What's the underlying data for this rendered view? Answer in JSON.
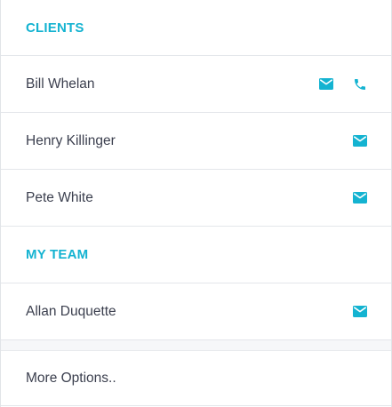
{
  "colors": {
    "accent": "#14b3d1",
    "text": "#3b3f4e",
    "divider": "#e3e6ea"
  },
  "clients": {
    "title": "CLIENTS",
    "contacts": [
      {
        "name": "Bill Whelan",
        "icons": [
          "email-icon",
          "phone-icon"
        ]
      },
      {
        "name": "Henry Killinger",
        "icons": [
          "email-icon"
        ]
      },
      {
        "name": "Pete White",
        "icons": [
          "email-icon"
        ]
      }
    ]
  },
  "team": {
    "title": "MY TEAM",
    "contacts": [
      {
        "name": "Allan Duquette",
        "icons": [
          "email-icon"
        ]
      }
    ]
  },
  "footer": {
    "more_label": "More Options.."
  }
}
